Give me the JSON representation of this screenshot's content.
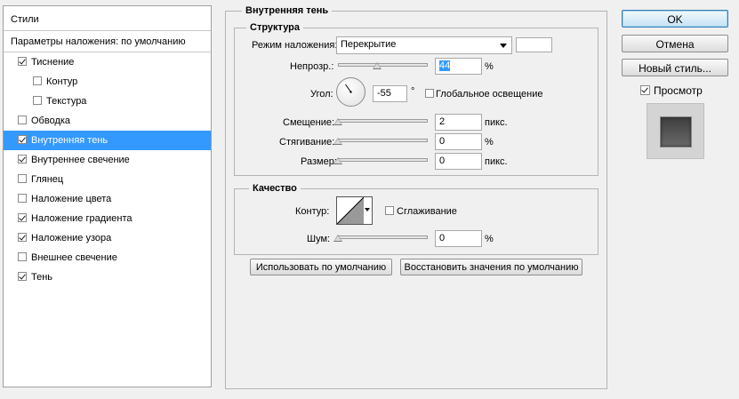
{
  "left": {
    "header": "Стили",
    "blending": "Параметры наложения: по умолчанию",
    "items": [
      {
        "label": "Тиснение",
        "checked": true,
        "indent": false,
        "selected": false
      },
      {
        "label": "Контур",
        "checked": false,
        "indent": true,
        "selected": false
      },
      {
        "label": "Текстура",
        "checked": false,
        "indent": true,
        "selected": false
      },
      {
        "label": "Обводка",
        "checked": false,
        "indent": false,
        "selected": false
      },
      {
        "label": "Внутренняя тень",
        "checked": true,
        "indent": false,
        "selected": true
      },
      {
        "label": "Внутреннее свечение",
        "checked": true,
        "indent": false,
        "selected": false
      },
      {
        "label": "Глянец",
        "checked": false,
        "indent": false,
        "selected": false
      },
      {
        "label": "Наложение цвета",
        "checked": false,
        "indent": false,
        "selected": false
      },
      {
        "label": "Наложение градиента",
        "checked": true,
        "indent": false,
        "selected": false
      },
      {
        "label": "Наложение узора",
        "checked": true,
        "indent": false,
        "selected": false
      },
      {
        "label": "Внешнее свечение",
        "checked": false,
        "indent": false,
        "selected": false
      },
      {
        "label": "Тень",
        "checked": true,
        "indent": false,
        "selected": false
      }
    ]
  },
  "panel": {
    "title": "Внутренняя тень",
    "structure": {
      "title": "Структура",
      "blend_mode_label": "Режим наложения:",
      "blend_mode_value": "Перекрытие",
      "blend_color": "#ffffff",
      "opacity_label": "Непрозр.:",
      "opacity_value": "44",
      "opacity_unit": "%",
      "opacity_level": 0.44,
      "angle_label": "Угол:",
      "angle_value": "-55",
      "angle_unit": "°",
      "global_light_label": "Глобальное освещение",
      "global_light_checked": false,
      "distance_label": "Смещение:",
      "distance_value": "2",
      "distance_unit": "пикс.",
      "distance_level": 0.0,
      "choke_label": "Стягивание:",
      "choke_value": "0",
      "choke_unit": "%",
      "choke_level": 0.0,
      "size_label": "Размер:",
      "size_value": "0",
      "size_unit": "пикс.",
      "size_level": 0.0
    },
    "quality": {
      "title": "Качество",
      "contour_label": "Контур:",
      "antialias_label": "Сглаживание",
      "antialias_checked": false,
      "noise_label": "Шум:",
      "noise_value": "0",
      "noise_unit": "%",
      "noise_level": 0.0
    },
    "default_button": "Использовать по умолчанию",
    "reset_button": "Восстановить значения по умолчанию"
  },
  "right": {
    "ok": "OK",
    "cancel": "Отмена",
    "new_style": "Новый стиль...",
    "preview_label": "Просмотр",
    "preview_checked": true
  }
}
